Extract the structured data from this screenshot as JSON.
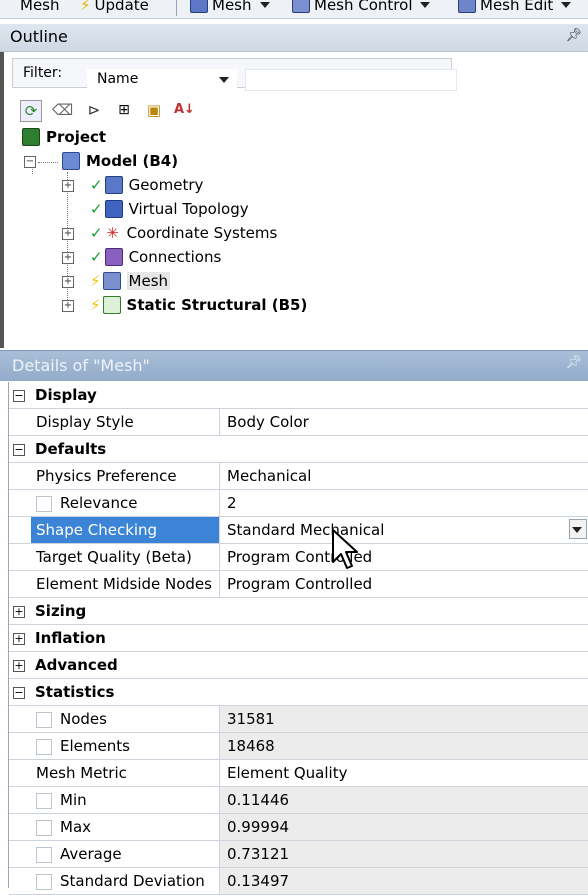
{
  "toolbar": {
    "items": [
      {
        "label": "Mesh",
        "icon": "mesh-icon"
      },
      {
        "label": "Update",
        "icon": "lightning-icon"
      },
      {
        "label": "Mesh",
        "icon": "mesh-icon"
      },
      {
        "label": "Mesh Control",
        "icon": "mesh-control-icon"
      },
      {
        "label": "Mesh Edit",
        "icon": "mesh-edit-icon"
      }
    ]
  },
  "outline": {
    "title": "Outline",
    "filter_label": "Filter:",
    "filter_value": "Name",
    "filter_text": "",
    "tree": [
      {
        "label": "Project",
        "bold": true,
        "level": 0
      },
      {
        "label": "Model (B4)",
        "bold": true,
        "level": 1
      },
      {
        "label": "Geometry",
        "level": 2,
        "status": "check"
      },
      {
        "label": "Virtual Topology",
        "level": 2,
        "status": "check"
      },
      {
        "label": "Coordinate Systems",
        "level": 2,
        "status": "check"
      },
      {
        "label": "Connections",
        "level": 2,
        "status": "check"
      },
      {
        "label": "Mesh",
        "level": 2,
        "status": "lightning",
        "selected": true
      },
      {
        "label": "Static Structural (B5)",
        "bold": true,
        "level": 2,
        "status": "lightning"
      }
    ]
  },
  "details": {
    "title": "Details of \"Mesh\"",
    "rows": [
      {
        "type": "category",
        "label": "Display",
        "expanded": true
      },
      {
        "type": "prop",
        "name": "Display Style",
        "value": "Body Color"
      },
      {
        "type": "category",
        "label": "Defaults",
        "expanded": true
      },
      {
        "type": "prop",
        "name": "Physics Preference",
        "value": "Mechanical"
      },
      {
        "type": "prop",
        "name": "Relevance",
        "value": "2",
        "checkbox": true
      },
      {
        "type": "prop",
        "name": "Shape Checking",
        "value": "Standard Mechanical",
        "selected": true,
        "dropdown": true
      },
      {
        "type": "prop",
        "name": "Target Quality (Beta)",
        "value": "Program Controlled"
      },
      {
        "type": "prop",
        "name": "Element Midside Nodes",
        "value": "Program Controlled"
      },
      {
        "type": "category",
        "label": "Sizing",
        "expanded": false
      },
      {
        "type": "category",
        "label": "Inflation",
        "expanded": false
      },
      {
        "type": "category",
        "label": "Advanced",
        "expanded": false
      },
      {
        "type": "category",
        "label": "Statistics",
        "expanded": true
      },
      {
        "type": "prop",
        "name": "Nodes",
        "value": "31581",
        "checkbox": true,
        "readonly": true
      },
      {
        "type": "prop",
        "name": "Elements",
        "value": "18468",
        "checkbox": true,
        "readonly": true
      },
      {
        "type": "prop",
        "name": "Mesh Metric",
        "value": "Element Quality"
      },
      {
        "type": "prop",
        "name": "Min",
        "value": "0.11446",
        "checkbox": true,
        "readonly": true
      },
      {
        "type": "prop",
        "name": "Max",
        "value": "0.99994",
        "checkbox": true,
        "readonly": true
      },
      {
        "type": "prop",
        "name": "Average",
        "value": "0.73121",
        "checkbox": true,
        "readonly": true
      },
      {
        "type": "prop",
        "name": "Standard Deviation",
        "value": "0.13497",
        "checkbox": true,
        "readonly": true
      }
    ]
  },
  "colors": {
    "selection": "#3c84d6",
    "details_header": "#a9bfd9",
    "check": "#1d9a36",
    "lightning": "#f0c400"
  }
}
